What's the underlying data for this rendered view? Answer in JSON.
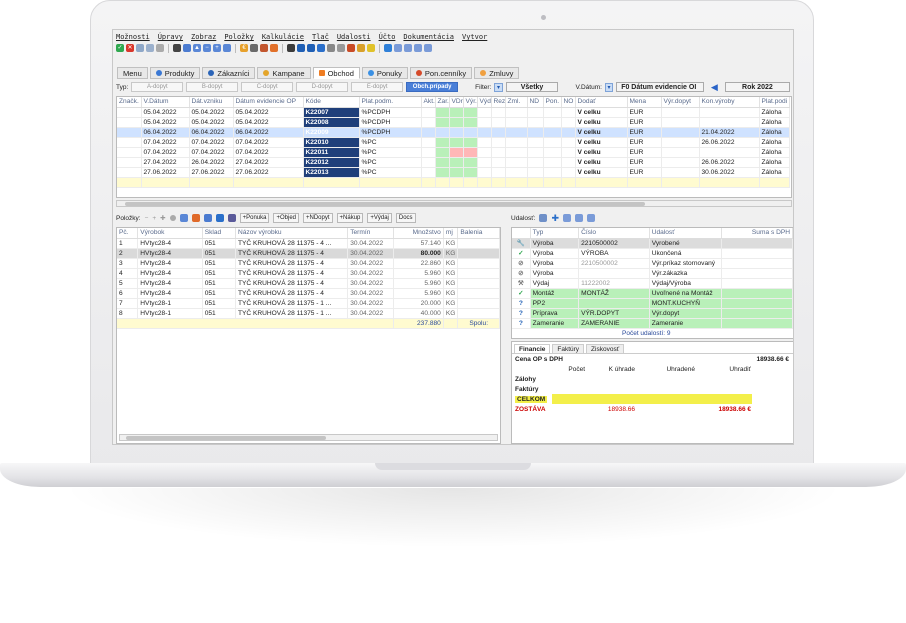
{
  "menu": [
    "Možnosti",
    "Úpravy",
    "Zobraz",
    "Položky",
    "Kalkulácie",
    "Tlač",
    "Udalosti",
    "Účto",
    "Dokumentácia",
    "Vytvor"
  ],
  "tabs": [
    "Menu",
    "Produkty",
    "Zákazníci",
    "Kampane",
    "Obchod",
    "Ponuky",
    "Pon.cenníky",
    "Zmluvy"
  ],
  "filter": {
    "typ_label": "Typ:",
    "buttons": [
      "A-dopyt",
      "B-dopyt",
      "C-dopyt",
      "D-dopyt",
      "E-dopyt",
      "Obch.prípady"
    ],
    "filter_label": "Filter:",
    "filter_value": "Všetky",
    "vdatum_label": "V.Dátum:",
    "vdatum_value": "F0  Dátum evidencie OI",
    "year": "Rok 2022"
  },
  "main_grid": {
    "headers": [
      "Značk.",
      "V.Dátum",
      "Dát.vzniku",
      "Dátum evidencie OP",
      "Kóde",
      "Plat.podm.",
      "Akt.",
      "Zar.",
      "VDr",
      "Výr.",
      "Výd.",
      "Rez",
      "Zml.",
      "ND",
      "Pon.",
      "NO",
      "Dodať",
      "Mena",
      "Výr.dopyt",
      "Kon.výroby",
      "Plat.podi"
    ],
    "rows": [
      [
        "",
        "05.04.2022",
        "05.04.2022",
        "05.04.2022",
        "K22007",
        "%PCDPH",
        "",
        "",
        "",
        "",
        "",
        "",
        "",
        "",
        "",
        "",
        "V celku",
        "EUR",
        "",
        "",
        "Záloha"
      ],
      [
        "",
        "05.04.2022",
        "05.04.2022",
        "05.04.2022",
        "K22008",
        "%PCDPH",
        "",
        "",
        "",
        "",
        "",
        "",
        "",
        "",
        "",
        "",
        "V celku",
        "EUR",
        "",
        "",
        "Záloha"
      ],
      [
        "",
        "06.04.2022",
        "06.04.2022",
        "06.04.2022",
        "K22009",
        "%PCDPH",
        "",
        "",
        "",
        "",
        "",
        "",
        "",
        "",
        "",
        "",
        "V celku",
        "EUR",
        "",
        "21.04.2022",
        "Záloha"
      ],
      [
        "",
        "07.04.2022",
        "07.04.2022",
        "07.04.2022",
        "K22010",
        "%PC",
        "",
        "",
        "",
        "",
        "",
        "",
        "",
        "",
        "",
        "",
        "V celku",
        "EUR",
        "",
        "26.06.2022",
        "Záloha"
      ],
      [
        "",
        "07.04.2022",
        "07.04.2022",
        "07.04.2022",
        "K22011",
        "%PC",
        "",
        "",
        "",
        "",
        "",
        "",
        "",
        "",
        "",
        "",
        "V celku",
        "EUR",
        "",
        "",
        "Záloha"
      ],
      [
        "",
        "27.04.2022",
        "26.04.2022",
        "27.04.2022",
        "K22012",
        "%PC",
        "",
        "",
        "",
        "",
        "",
        "",
        "",
        "",
        "",
        "",
        "V celku",
        "EUR",
        "",
        "26.06.2022",
        "Záloha"
      ],
      [
        "",
        "27.06.2022",
        "27.06.2022",
        "27.06.2022",
        "K22013",
        "%PC",
        "",
        "",
        "",
        "",
        "",
        "",
        "",
        "",
        "",
        "",
        "V celku",
        "EUR",
        "",
        "30.06.2022",
        "Záloha"
      ]
    ]
  },
  "items": {
    "label": "Položky:",
    "buttons": [
      "+Ponuka",
      "+Objed",
      "+NDopyt",
      "+Nákup",
      "+Výdaj",
      "Docs"
    ],
    "headers": [
      "Pč.",
      "Výrobok",
      "Sklad",
      "Názov výrobku",
      "Termín",
      "Množstvo",
      "mj",
      "Balenia"
    ],
    "rows": [
      [
        "1",
        "HVtyc28-4",
        "051",
        "TYČ KRUHOVÁ 28 11375 - 4 ...",
        "30.04.2022",
        "57.140",
        "KG",
        ""
      ],
      [
        "2",
        "HVtyc28-4",
        "051",
        "TYČ KRUHOVÁ 28 11375 - 4",
        "30.04.2022",
        "80.000",
        "KG",
        ""
      ],
      [
        "3",
        "HVtyc28-4",
        "051",
        "TYČ KRUHOVÁ 28 11375 - 4",
        "30.04.2022",
        "22.860",
        "KG",
        ""
      ],
      [
        "4",
        "HVtyc28-4",
        "051",
        "TYČ KRUHOVÁ 28 11375 - 4",
        "30.04.2022",
        "5.960",
        "KG",
        ""
      ],
      [
        "5",
        "HVtyc28-4",
        "051",
        "TYČ KRUHOVÁ 28 11375 - 4",
        "30.04.2022",
        "5.960",
        "KG",
        ""
      ],
      [
        "6",
        "HVtyc28-4",
        "051",
        "TYČ KRUHOVÁ 28 11375 - 4",
        "30.04.2022",
        "5.960",
        "KG",
        ""
      ],
      [
        "7",
        "HVtyc28-1",
        "051",
        "TYČ KRUHOVÁ 28 11375 - 1 ...",
        "30.04.2022",
        "20.000",
        "KG",
        ""
      ],
      [
        "8",
        "HVtyc28-1",
        "051",
        "TYČ KRUHOVÁ 28 11375 - 1 ...",
        "30.04.2022",
        "40.000",
        "KG",
        ""
      ]
    ],
    "total": "237.880",
    "total_label": "Spolu:"
  },
  "events": {
    "label": "Udalosť:",
    "headers": [
      "Typ",
      "Číslo",
      "Udalosť",
      "Suma s DPH"
    ],
    "rows": [
      [
        "Výroba",
        "2210500002",
        "Vyrobené"
      ],
      [
        "Výroba",
        "VÝROBA",
        "Ukončená"
      ],
      [
        "Výroba",
        "2210500002",
        "Výr.príkaz stornovaný"
      ],
      [
        "Výroba",
        "",
        "Výr.zákazka"
      ],
      [
        "Výdaj",
        "11222002",
        "Výdaj/Výroba"
      ],
      [
        "Montáž",
        "MONTÁŽ",
        "Uvoľnené na Montáž"
      ],
      [
        "PP2",
        "",
        "MONT.KUCHYŇ"
      ],
      [
        "Príprava",
        "VÝR.DOPYT",
        "Výr.dopyt"
      ],
      [
        "Zameranie",
        "ZAMERANIE",
        "Zameranie"
      ]
    ],
    "count_label": "Počet udalostí:",
    "count": "9"
  },
  "finance": {
    "tabs": [
      "Financie",
      "Faktúry",
      "Ziskovosť"
    ],
    "cena_label": "Cena OP s DPH",
    "cena_value": "18938.66 €",
    "cols": [
      "Počet",
      "K úhrade",
      "Uhradené",
      "Uhradiť"
    ],
    "zalohy": "Zálohy",
    "faktury": "Faktúry",
    "celkom": "CELKOM",
    "zostava": "ZOSTÁVA",
    "zostava_k_uhrade": "18938.66",
    "zostava_uhradit": "18938.66 €"
  },
  "colors": {
    "accent": "#4a7fd8",
    "kode_bg": "#1f3f7a",
    "selection": "#cfe2ff",
    "green": "#b9f0b9",
    "red": "#cc0000"
  }
}
